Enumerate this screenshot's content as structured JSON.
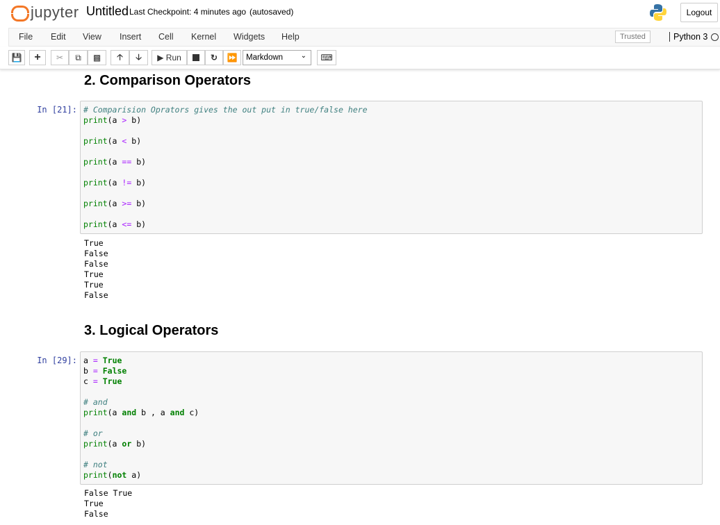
{
  "header": {
    "logo": "jupyter",
    "title": "Untitled",
    "checkpoint": "Last Checkpoint: 4 minutes ago",
    "autosaved": "(autosaved)",
    "logout": "Logout"
  },
  "menu": {
    "items": [
      "File",
      "Edit",
      "View",
      "Insert",
      "Cell",
      "Kernel",
      "Widgets",
      "Help"
    ],
    "trusted": "Trusted",
    "kernel": "Python 3"
  },
  "toolbar": {
    "run": "Run",
    "cell_type": "Markdown"
  },
  "sections": [
    {
      "heading": "2. Comparison Operators",
      "prompt": "In [21]:",
      "code": [
        [
          [
            "# Comparision Oprators gives the out put in true/false here",
            "cm"
          ]
        ],
        [
          [
            "print",
            "fn"
          ],
          [
            "(a ",
            ""
          ],
          [
            ">",
            "op"
          ],
          [
            " b)",
            ""
          ]
        ],
        [],
        [
          [
            "print",
            "fn"
          ],
          [
            "(a ",
            ""
          ],
          [
            "<",
            "op"
          ],
          [
            " b)",
            ""
          ]
        ],
        [],
        [
          [
            "print",
            "fn"
          ],
          [
            "(a ",
            ""
          ],
          [
            "==",
            "op"
          ],
          [
            " b)",
            ""
          ]
        ],
        [],
        [
          [
            "print",
            "fn"
          ],
          [
            "(a ",
            ""
          ],
          [
            "!=",
            "op"
          ],
          [
            " b)",
            ""
          ]
        ],
        [],
        [
          [
            "print",
            "fn"
          ],
          [
            "(a ",
            ""
          ],
          [
            ">=",
            "op"
          ],
          [
            " b)",
            ""
          ]
        ],
        [],
        [
          [
            "print",
            "fn"
          ],
          [
            "(a ",
            ""
          ],
          [
            "<=",
            "op"
          ],
          [
            " b)",
            ""
          ]
        ]
      ],
      "output": "True\nFalse\nFalse\nTrue\nTrue\nFalse"
    },
    {
      "heading": "3. Logical Operators",
      "prompt": "In [29]:",
      "code": [
        [
          [
            "a ",
            ""
          ],
          [
            "=",
            "op"
          ],
          [
            " ",
            ""
          ],
          [
            "True",
            "kw"
          ]
        ],
        [
          [
            "b ",
            ""
          ],
          [
            "=",
            "op"
          ],
          [
            " ",
            ""
          ],
          [
            "False",
            "kw"
          ]
        ],
        [
          [
            "c ",
            ""
          ],
          [
            "=",
            "op"
          ],
          [
            " ",
            ""
          ],
          [
            "True",
            "kw"
          ]
        ],
        [],
        [
          [
            "# and",
            "cm"
          ]
        ],
        [
          [
            "print",
            "fn"
          ],
          [
            "(a ",
            ""
          ],
          [
            "and",
            "kw"
          ],
          [
            " b , a ",
            ""
          ],
          [
            "and",
            "kw"
          ],
          [
            " c)",
            ""
          ]
        ],
        [],
        [
          [
            "# or",
            "cm"
          ]
        ],
        [
          [
            "print",
            "fn"
          ],
          [
            "(a ",
            ""
          ],
          [
            "or",
            "kw"
          ],
          [
            " b)",
            ""
          ]
        ],
        [],
        [
          [
            "# not",
            "cm"
          ]
        ],
        [
          [
            "print",
            "fn"
          ],
          [
            "(",
            ""
          ],
          [
            "not",
            "kw"
          ],
          [
            " a)",
            ""
          ]
        ]
      ],
      "output": "False True\nTrue\nFalse"
    }
  ]
}
